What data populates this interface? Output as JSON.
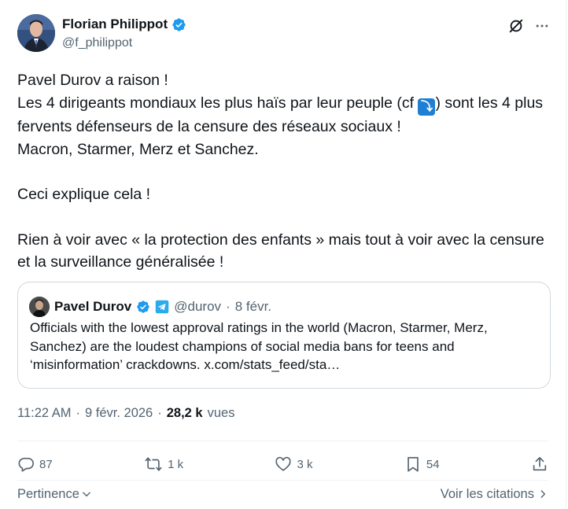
{
  "author": {
    "name": "Florian Philippot",
    "handle": "@f_philippot",
    "verified": true
  },
  "post": {
    "line1": "Pavel Durov a raison !",
    "line2a": "Les 4 dirigeants mondiaux les plus haïs par leur peuple (cf ",
    "line2b": ") sont les 4 plus fervents défenseurs de la censure des réseaux sociaux !",
    "line3": "Macron, Starmer, Merz et Sanchez.",
    "line4": "Ceci explique cela !",
    "line5": "Rien à voir avec « la protection des enfants » mais tout à voir avec la censure et la surveillance généralisée !",
    "emoji_icon": "arrow-down-right-emoji",
    "emoji_glyph": "⤵"
  },
  "quote": {
    "name": "Pavel Durov",
    "handle": "@durov",
    "separator": "·",
    "date": "8 févr.",
    "text": "Officials with the lowest approval ratings in the world (Macron, Starmer, Merz, Sanchez) are the loudest champions of social media bans for teens and ‘misinformation’ crackdowns. x.com/stats_feed/sta…"
  },
  "meta": {
    "time": "11:22 AM",
    "sep1": "·",
    "date": "9 févr. 2026",
    "sep2": "·",
    "views_count": "28,2 k",
    "views_label": "vues"
  },
  "actions": {
    "replies": "87",
    "reposts": "1 k",
    "likes": "3 k",
    "bookmarks": "54"
  },
  "footer": {
    "sort_label": "Pertinence",
    "quotes_link": "Voir les citations"
  },
  "colors": {
    "verified": "#1d9bf0",
    "secondary_text": "#536471",
    "primary_text": "#0f1419",
    "telegram": "#2aabee"
  }
}
